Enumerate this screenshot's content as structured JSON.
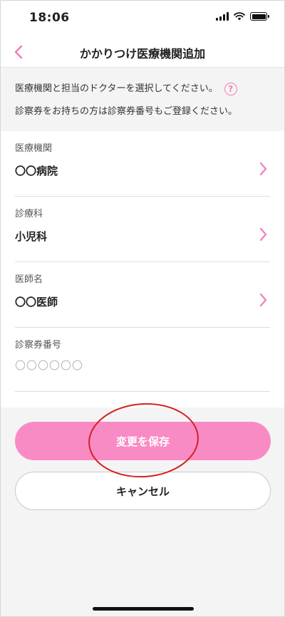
{
  "status_bar": {
    "time": "18:06"
  },
  "nav": {
    "title": "かかりつけ医療機関追加"
  },
  "info": {
    "line1": "医療機関と担当のドクターを選択してください。",
    "line2": "診察券をお持ちの方は診察券番号もご登録ください。",
    "help_icon_glyph": "?"
  },
  "form": {
    "fields": [
      {
        "label": "医療機関",
        "value": "〇〇病院"
      },
      {
        "label": "診療科",
        "value": "小児科"
      },
      {
        "label": "医師名",
        "value": "〇〇医師"
      },
      {
        "label": "診察券番号",
        "placeholder": "〇〇〇〇〇〇"
      }
    ]
  },
  "buttons": {
    "save_label": "変更を保存",
    "cancel_label": "キャンセル"
  },
  "colors": {
    "accent": "#f98bc4",
    "annotation": "#d81e1e"
  },
  "icons": {
    "back": "chevron-left-icon",
    "row": "chevron-right-icon",
    "help": "question-circle-icon"
  }
}
